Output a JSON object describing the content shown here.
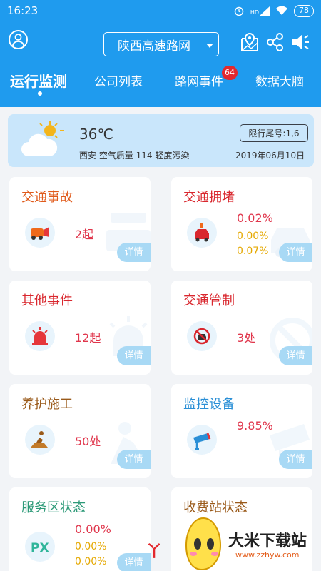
{
  "status_bar": {
    "time": "16:23",
    "signal_text": "HD",
    "battery": "78"
  },
  "header": {
    "network_name": "陕西高速路网",
    "tabs": [
      {
        "label": "运行监测"
      },
      {
        "label": "公司列表"
      },
      {
        "label": "路网事件"
      },
      {
        "label": "数据大脑"
      }
    ],
    "event_badge": "64",
    "icons": [
      "avatar-icon",
      "map-pin-icon",
      "share-icon",
      "sound-icon"
    ]
  },
  "weather": {
    "temperature": "36℃",
    "info": "西安 空气质量 114 轻度污染",
    "limit": "限行尾号:1,6",
    "date": "2019年06月10日"
  },
  "cards": [
    {
      "title": "交通事故",
      "value": "2起",
      "detail": "详情",
      "icon": "car-crash-icon"
    },
    {
      "title": "交通拥堵",
      "value": "0.02%",
      "sub1": "0.00%",
      "sub2": "0.07%",
      "detail": "详情",
      "icon": "traffic-jam-icon"
    },
    {
      "title": "其他事件",
      "value": "12起",
      "detail": "详情",
      "icon": "siren-icon"
    },
    {
      "title": "交通管制",
      "value": "3处",
      "detail": "详情",
      "icon": "no-car-icon"
    },
    {
      "title": "养护施工",
      "value": "50处",
      "detail": "详情",
      "icon": "worker-icon"
    },
    {
      "title": "监控设备",
      "value": "9.85%",
      "detail": "详情",
      "icon": "camera-icon"
    },
    {
      "title": "服务区状态",
      "value": "0.00%",
      "sub1": "0.00%",
      "sub2": "0.00%",
      "detail": "详情",
      "icon": "px-icon"
    },
    {
      "title": "收费站状态",
      "icon": "toll-icon"
    }
  ],
  "watermark": {
    "brand": "大米下载站",
    "url": "www.zzhyw.com",
    "logo_text": "丫"
  },
  "colors": {
    "header_blue": "#1f9bee",
    "title_orange": "#e05a1a",
    "title_red": "#d9272e",
    "title_brown": "#9a5a1a",
    "title_blue": "#2a8fd6",
    "title_green": "#2d9a78",
    "value_red": "#e0364c",
    "value_yellow": "#e5a800"
  }
}
